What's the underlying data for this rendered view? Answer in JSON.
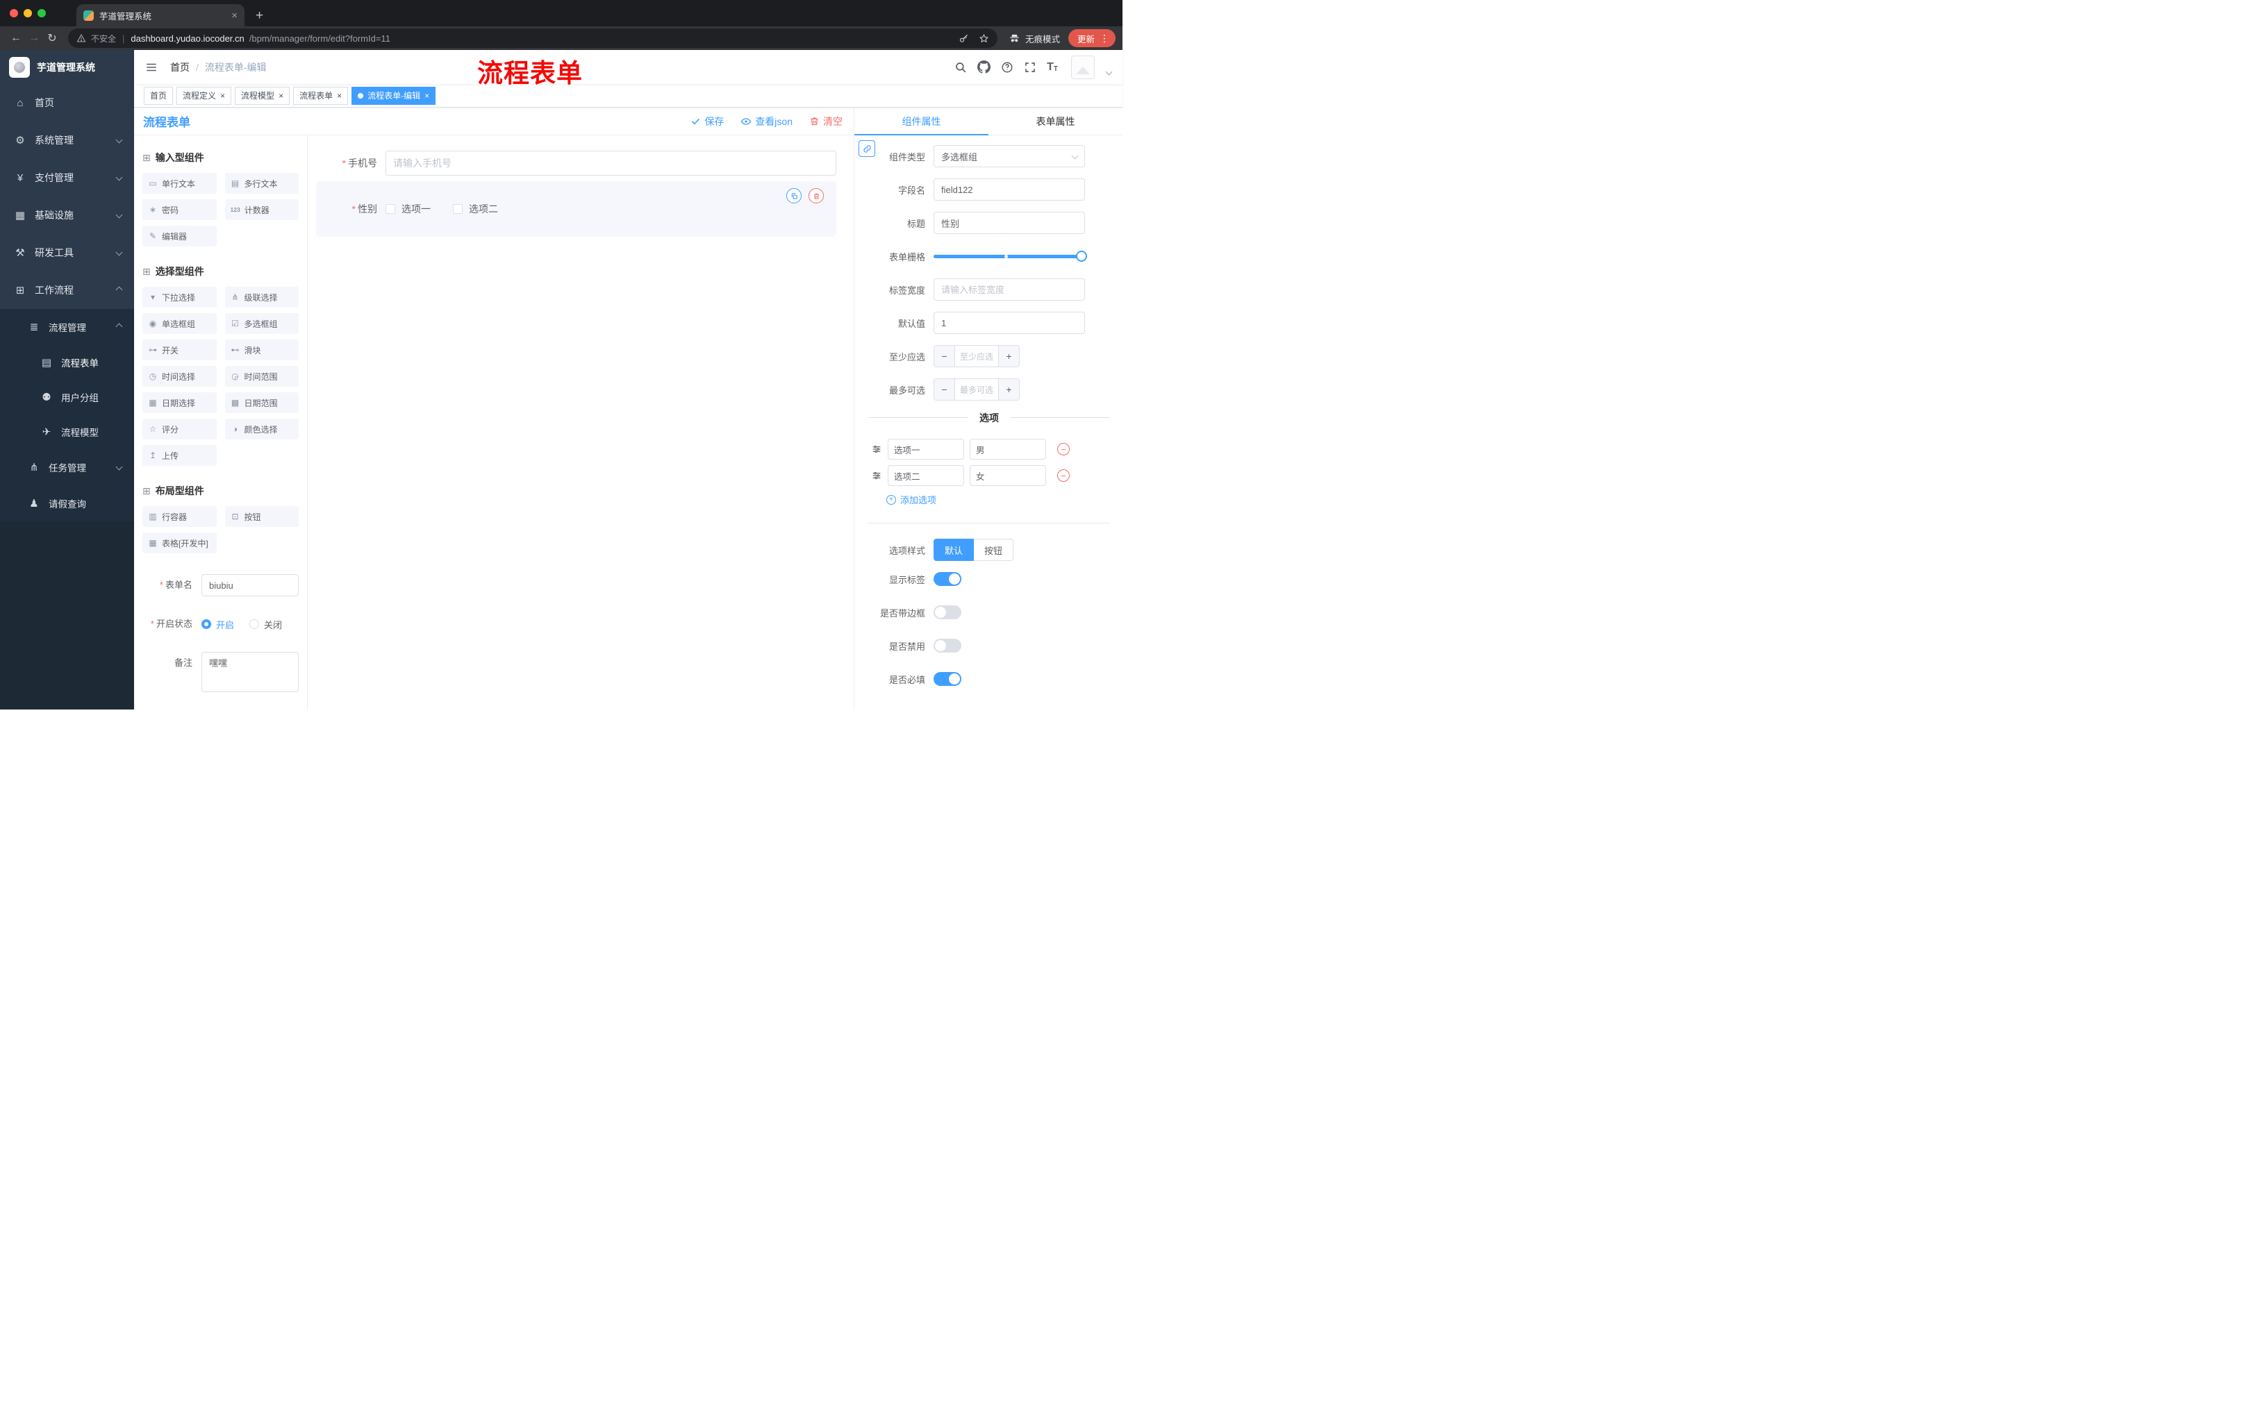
{
  "browser": {
    "tab_title": "芋道管理系统",
    "security_label": "不安全",
    "url_domain": "dashboard.yudao.iocoder.cn",
    "url_path": "/bpm/manager/form/edit?formId=11",
    "incognito_label": "无痕模式",
    "update_label": "更新"
  },
  "annotation_text": "流程表单",
  "sidebar": {
    "app_title": "芋道管理系统",
    "menu": [
      {
        "label": "首页",
        "icon": "home-icon",
        "glyph": "⌂"
      },
      {
        "label": "系统管理",
        "icon": "gear-icon",
        "glyph": "⚙"
      },
      {
        "label": "支付管理",
        "icon": "yen-icon",
        "glyph": "¥"
      },
      {
        "label": "基础设施",
        "icon": "infrastructure-icon",
        "glyph": "▦"
      },
      {
        "label": "研发工具",
        "icon": "tools-icon",
        "glyph": "⚒"
      },
      {
        "label": "工作流程",
        "icon": "workflow-icon",
        "glyph": "⊞"
      },
      {
        "label": "流程管理",
        "icon": "process-list-icon",
        "glyph": "≣"
      },
      {
        "label": "流程表单",
        "icon": "form-icon",
        "glyph": "▤"
      },
      {
        "label": "用户分组",
        "icon": "user-group-icon",
        "glyph": "⚉"
      },
      {
        "label": "流程模型",
        "icon": "send-icon",
        "glyph": "✈"
      },
      {
        "label": "任务管理",
        "icon": "task-tree-icon",
        "glyph": "⋔"
      },
      {
        "label": "请假查询",
        "icon": "person-icon",
        "glyph": "♟"
      }
    ]
  },
  "breadcrumb": {
    "root": "首页",
    "current": "流程表单-编辑"
  },
  "tags": [
    {
      "label": "首页"
    },
    {
      "label": "流程定义"
    },
    {
      "label": "流程模型"
    },
    {
      "label": "流程表单"
    },
    {
      "label": "流程表单-编辑"
    }
  ],
  "designer": {
    "title": "流程表单",
    "save_label": "保存",
    "view_json_label": "查看json",
    "clear_label": "清空"
  },
  "components": {
    "group1_title": "输入型组件",
    "group1": [
      {
        "label": "单行文本",
        "icon": "text-input-icon",
        "glyph": "▭"
      },
      {
        "label": "多行文本",
        "icon": "textarea-icon",
        "glyph": "▤"
      },
      {
        "label": "密码",
        "icon": "password-icon",
        "glyph": "∗"
      },
      {
        "label": "计数器",
        "icon": "counter-icon",
        "glyph": "123"
      },
      {
        "label": "编辑器",
        "icon": "editor-icon",
        "glyph": "✎"
      }
    ],
    "group2_title": "选择型组件",
    "group2": [
      {
        "label": "下拉选择",
        "icon": "select-icon",
        "glyph": "▾"
      },
      {
        "label": "级联选择",
        "icon": "cascader-icon",
        "glyph": "⋔"
      },
      {
        "label": "单选框组",
        "icon": "radio-group-icon",
        "glyph": "◉"
      },
      {
        "label": "多选框组",
        "icon": "checkbox-group-icon",
        "glyph": "☑"
      },
      {
        "label": "开关",
        "icon": "switch-icon",
        "glyph": "⊶"
      },
      {
        "label": "滑块",
        "icon": "slider-icon",
        "glyph": "⊷"
      },
      {
        "label": "时间选择",
        "icon": "time-picker-icon",
        "glyph": "◷"
      },
      {
        "label": "时间范围",
        "icon": "time-range-icon",
        "glyph": "◶"
      },
      {
        "label": "日期选择",
        "icon": "date-picker-icon",
        "glyph": "▦"
      },
      {
        "label": "日期范围",
        "icon": "date-range-icon",
        "glyph": "▩"
      },
      {
        "label": "评分",
        "icon": "rate-icon",
        "glyph": "☆"
      },
      {
        "label": "颜色选择",
        "icon": "color-picker-icon",
        "glyph": "◑"
      },
      {
        "label": "上传",
        "icon": "upload-icon",
        "glyph": "↥"
      }
    ],
    "group3_title": "布局型组件",
    "group3": [
      {
        "label": "行容器",
        "icon": "row-container-icon",
        "glyph": "▥"
      },
      {
        "label": "按钮",
        "icon": "button-icon",
        "glyph": "⊡"
      },
      {
        "label": "表格[开发中]",
        "icon": "table-icon",
        "glyph": "▦"
      }
    ]
  },
  "form_meta": {
    "name_label": "表单名",
    "name_value": "biubiu",
    "status_label": "开启状态",
    "status_on": "开启",
    "status_off": "关闭",
    "remark_label": "备注",
    "remark_value": "嘿嘿"
  },
  "canvas": {
    "phone_label": "手机号",
    "phone_placeholder": "请输入手机号",
    "gender_label": "性别",
    "gender_option1": "选项一",
    "gender_option2": "选项二"
  },
  "props": {
    "tab_component": "组件属性",
    "tab_form": "表单属性",
    "type_label": "组件类型",
    "type_value": "多选框组",
    "field_label": "字段名",
    "field_value": "field122",
    "title_label": "标题",
    "title_value": "性别",
    "grid_label": "表单栅格",
    "label_width_label": "标签宽度",
    "label_width_placeholder": "请输入标签宽度",
    "default_label": "默认值",
    "default_value": "1",
    "min_label": "至少应选",
    "min_placeholder": "至少应选",
    "max_label": "最多可选",
    "max_placeholder": "最多可选",
    "options_title": "选项",
    "option1_label": "选项一",
    "option1_value": "男",
    "option2_label": "选项二",
    "option2_value": "女",
    "add_option_label": "添加选项",
    "option_style_label": "选项样式",
    "style_default": "默认",
    "style_button": "按钮",
    "show_label_label": "显示标签",
    "border_label": "是否带边框",
    "disabled_label": "是否禁用",
    "required_label": "是否必填",
    "switch_states": {
      "show_label": true,
      "border": false,
      "disabled": false,
      "required": true
    },
    "accent_color": "#409eff",
    "danger_color": "#f56c6c"
  }
}
